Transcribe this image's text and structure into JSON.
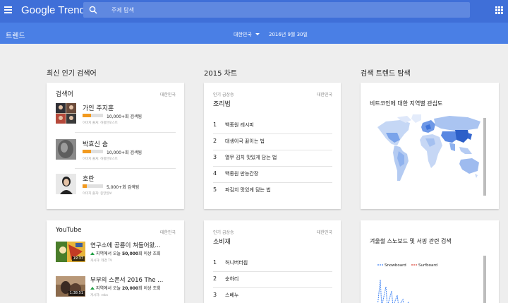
{
  "header": {
    "brand": "Google Trends",
    "search_placeholder": "주제 탐색",
    "subtitle": "트렌드",
    "region": "대한민국",
    "date": "2016년 9월 30일"
  },
  "columns": [
    {
      "title": "최신 인기 검색어"
    },
    {
      "title": "2015 차트"
    },
    {
      "title": "검색 트렌드 탐색"
    }
  ],
  "searches_card": {
    "title": "검색어",
    "region": "대한민국",
    "items": [
      {
        "title": "가인 주지훈",
        "count": "10,000+회 검색됨",
        "source": "이미지 출처: 허핑턴포스트",
        "bar_fill": 0.4
      },
      {
        "title": "박효신 숨",
        "count": "10,000+회 검색됨",
        "source": "이미지 출처: 허핑턴포스트",
        "bar_fill": 0.4
      },
      {
        "title": "호란",
        "count": "5,000+회 검색됨",
        "source": "이미지 출처: 중앙일보",
        "bar_fill": 0.2
      }
    ]
  },
  "recipe_card": {
    "sub": "인기 급상승",
    "region": "대한민국",
    "title": "조리법",
    "items": [
      {
        "num": "1",
        "label": "백종원 레시피"
      },
      {
        "num": "2",
        "label": "대생이국 끓이는 법"
      },
      {
        "num": "3",
        "label": "열무 김치 맛있게 담는 법"
      },
      {
        "num": "4",
        "label": "백종원 만능간장"
      },
      {
        "num": "5",
        "label": "파김치 맛있게 담는 법"
      }
    ]
  },
  "explore_card1": {
    "title": "비트코인에 대한 지역별 관심도"
  },
  "youtube_card": {
    "title": "YouTube",
    "region": "대한민국",
    "items": [
      {
        "title": "연구소에 공룡이 쳐들어왔...",
        "stat_prefix": "지역에서 오늘 ",
        "stat_num": "50,000",
        "stat_suffix": "회 이상 조회",
        "source": "게시자: 데경 TV",
        "duration": "19:37"
      },
      {
        "title": "부부의 스폰서 2016 The ...",
        "stat_prefix": "지역에서 오늘 ",
        "stat_num": "20,000",
        "stat_suffix": "회 이상 조회",
        "source": "게시자: rebs",
        "duration": "1:38:51"
      }
    ]
  },
  "consumer_card": {
    "sub": "인기 급상승",
    "region": "대한민국",
    "title": "소비재",
    "items": [
      {
        "num": "1",
        "label": "허니버터칩"
      },
      {
        "num": "2",
        "label": "순하리"
      },
      {
        "num": "3",
        "label": "스베누"
      }
    ]
  },
  "explore_card2": {
    "title": "겨울철 스노보드 및 서핑 관련 검색",
    "legend": [
      {
        "name": "Snowboard",
        "color": "#4285f4"
      },
      {
        "name": "Surfboard",
        "color": "#db4437"
      }
    ]
  },
  "colors": {
    "topbar": "#3f6fd8",
    "subbar": "#4a7fe5",
    "accent_bar": "#f29a1f",
    "up_arrow": "#21a045"
  }
}
